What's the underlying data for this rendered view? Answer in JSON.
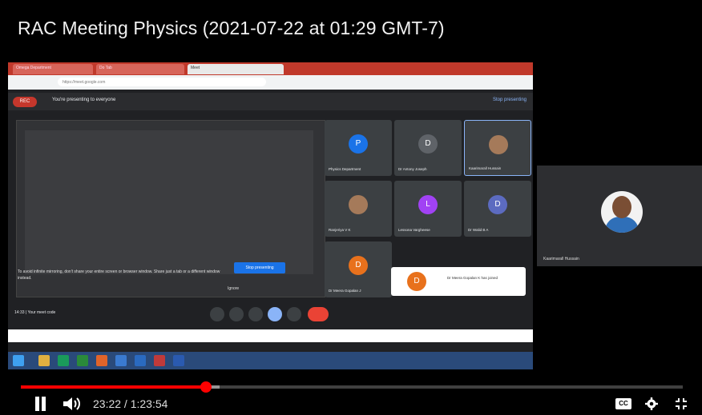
{
  "player": {
    "title": "RAC Meeting Physics (2021-07-22 at 01:29 GMT-7)",
    "time_display": "23:22 / 1:23:54",
    "progress_played_fraction": 0.28,
    "progress_loaded_fraction": 0.3,
    "colors": {
      "accent": "#ff0000",
      "background": "#000000"
    },
    "icons": [
      "pause-icon",
      "volume-icon",
      "cc-icon",
      "gear-icon",
      "exit-fullscreen-icon"
    ],
    "cc_label": "CC"
  },
  "recording": {
    "meet": {
      "presenting_text": "You're presenting to everyone",
      "stop_presenting_top": "Stop presenting",
      "rec_label": "REC",
      "stop_presenting_button": "Stop presenting",
      "warning_text": "To avoid infinite mirroring, don't share your entire screen or browser window. Share just a tab or a different window instead.",
      "ignore_label": "Ignore",
      "meeting_info": "14:33 | Your meet code",
      "participants": [
        {
          "name": "Physics Department",
          "initial": "P",
          "color": "#1a73e8"
        },
        {
          "name": "Dr Antony Joseph",
          "initial": "D",
          "color": "#5f6368"
        },
        {
          "name": "Kaarimarall Hussain",
          "initial": "",
          "color": "#a57a5a"
        },
        {
          "name": "Ranjeriya V K",
          "initial": "",
          "color": "#a57a5a"
        },
        {
          "name": "Lessona Vargheese",
          "initial": "L",
          "color": "#a142f4"
        },
        {
          "name": "Dr Walid B A",
          "initial": "D",
          "color": "#5c6bc0"
        },
        {
          "name": "Dr Meera Gopalan J",
          "initial": "D",
          "color": "#e8711c"
        }
      ],
      "toast": {
        "initial": "D",
        "text": "Dr Meera Gopalan K has joined"
      }
    }
  },
  "right_panel": {
    "name": "Kaarimarall Hussain"
  }
}
